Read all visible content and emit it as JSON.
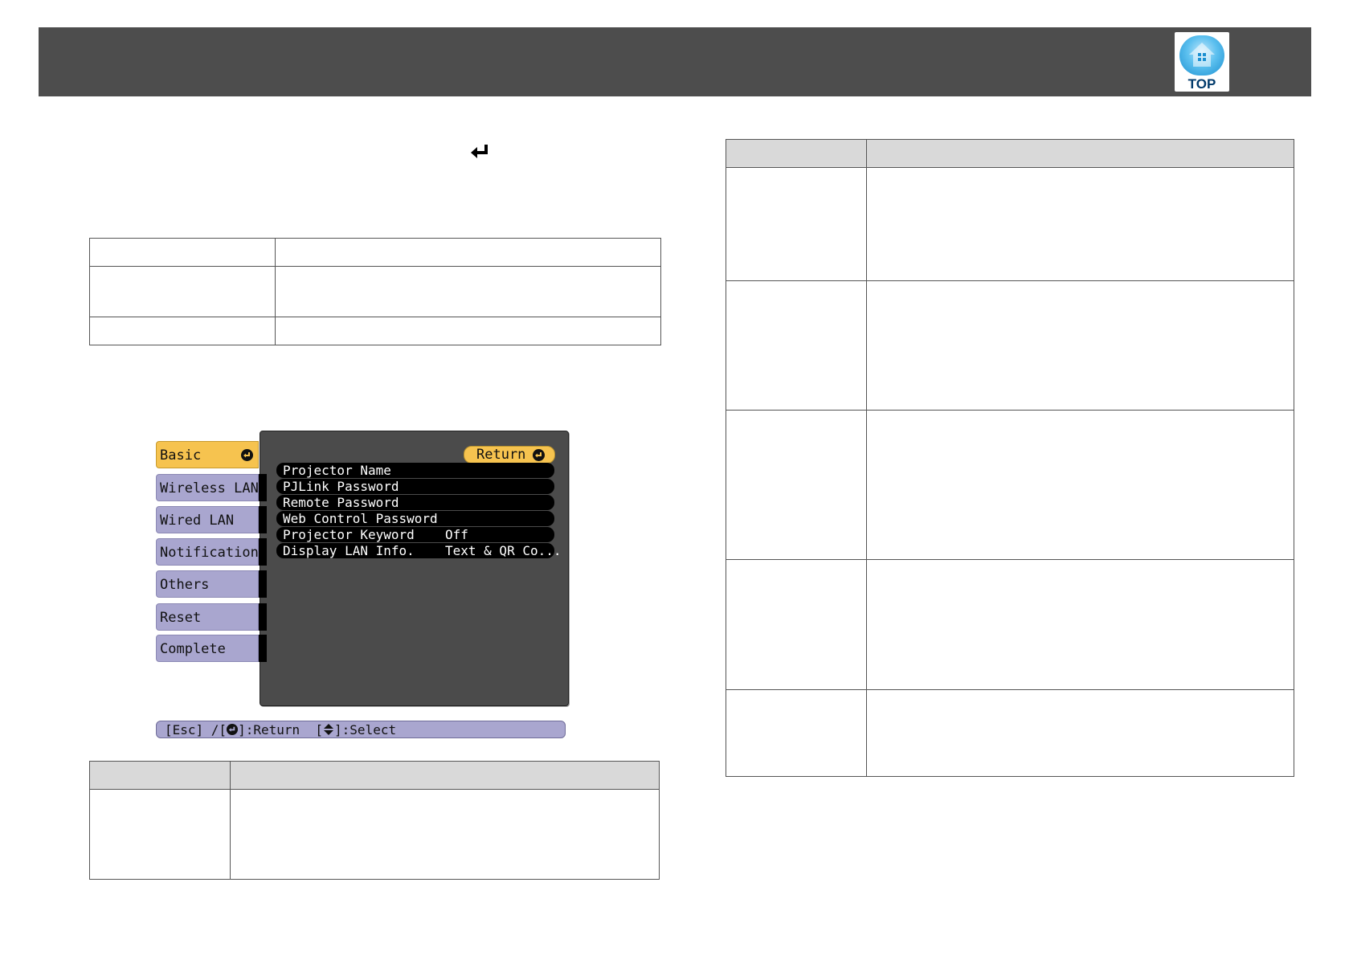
{
  "header": {
    "logo_text": "TOP"
  },
  "osd": {
    "tabs": [
      {
        "label": "Basic",
        "active": true
      },
      {
        "label": "Wireless LAN",
        "active": false
      },
      {
        "label": "Wired LAN",
        "active": false
      },
      {
        "label": "Notification",
        "active": false
      },
      {
        "label": "Others",
        "active": false
      },
      {
        "label": "Reset",
        "active": false
      },
      {
        "label": "Complete",
        "active": false
      }
    ],
    "return_label": "Return",
    "items": [
      {
        "name": "Projector Name",
        "value": ""
      },
      {
        "name": "PJLink Password",
        "value": ""
      },
      {
        "name": "Remote Password",
        "value": ""
      },
      {
        "name": "Web Control Password",
        "value": ""
      },
      {
        "name": "Projector Keyword",
        "value": "Off"
      },
      {
        "name": "Display LAN Info.",
        "value": "Text & QR Co..."
      }
    ],
    "status_bar": {
      "part1": "[Esc] /[",
      "part2": "]:Return  [",
      "part3": "]:Select"
    }
  },
  "colors": {
    "header": "#4d4d4d",
    "tab": "#a9a6cf",
    "tab_active": "#f6c34f",
    "panel": "#4b4b4b",
    "table_header": "#d9d9d9"
  }
}
